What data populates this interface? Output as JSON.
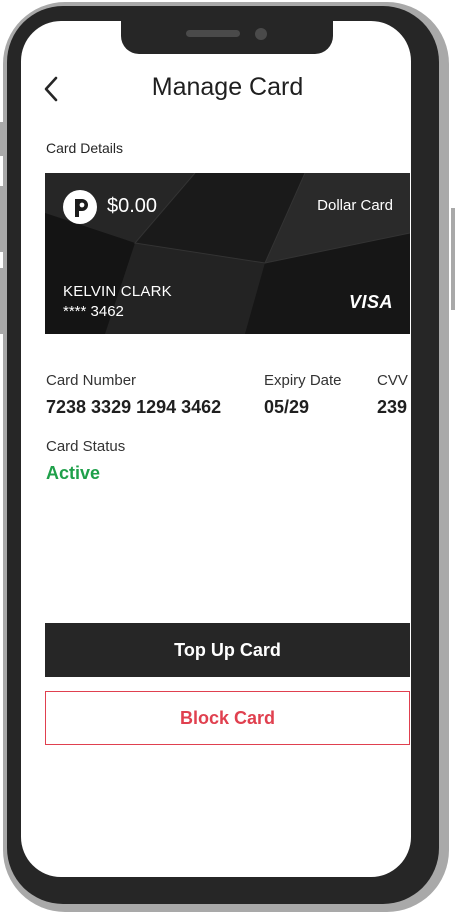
{
  "header": {
    "title": "Manage Card",
    "back_icon": "chevron-left-icon"
  },
  "section": {
    "card_details_label": "Card Details"
  },
  "card": {
    "balance": "$0.00",
    "type": "Dollar Card",
    "holder_name": "KELVIN CLARK",
    "masked_number": "**** 3462",
    "brand": "VISA",
    "logo_icon": "p-logo-icon"
  },
  "details": {
    "card_number_label": "Card Number",
    "card_number": "7238 3329 1294 3462",
    "expiry_label": "Expiry Date",
    "expiry": "05/29",
    "cvv_label": "CVV",
    "cvv": "239",
    "status_label": "Card Status",
    "status": "Active"
  },
  "actions": {
    "top_up_label": "Top Up Card",
    "block_label": "Block Card"
  },
  "colors": {
    "primary_dark": "#262626",
    "status_active": "#1fa04a",
    "danger": "#e0404f"
  }
}
